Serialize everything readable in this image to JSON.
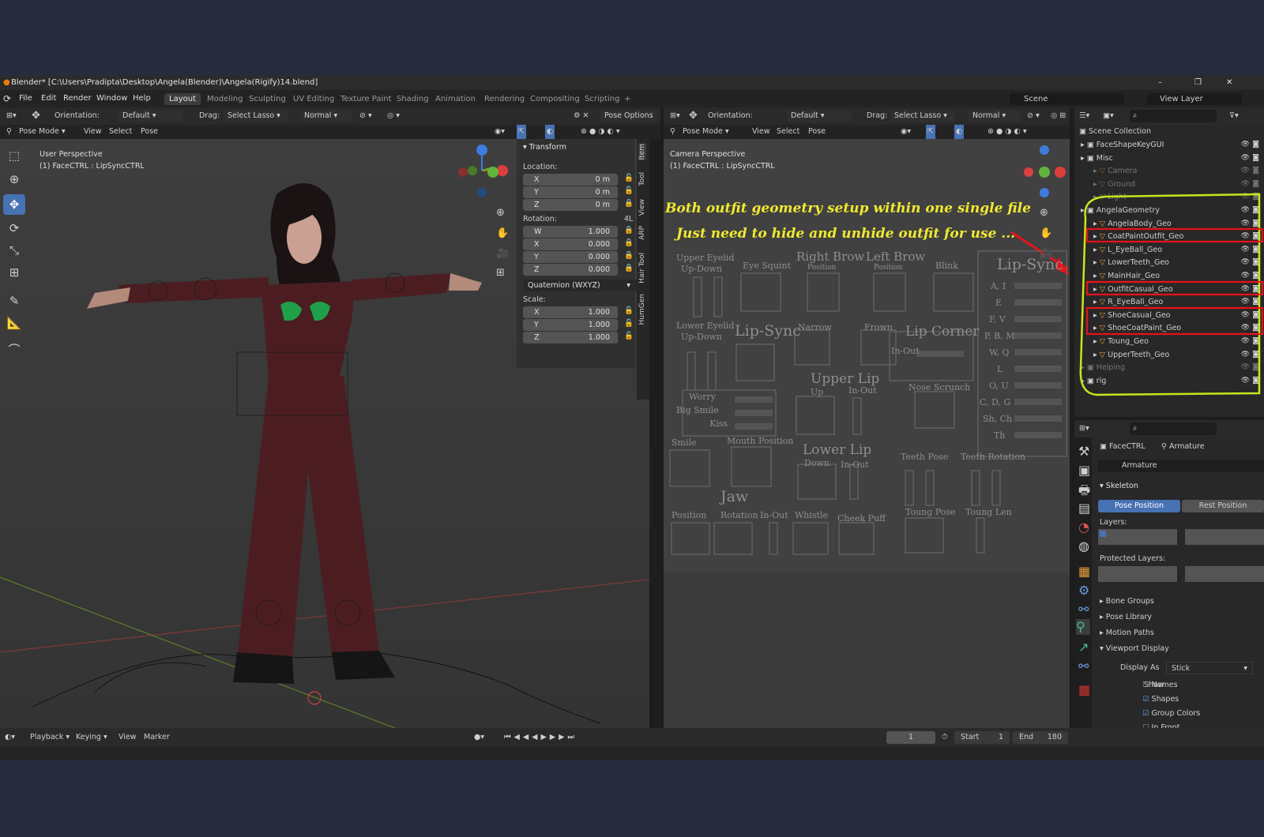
{
  "window": {
    "title": "Blender* [C:\\Users\\Pradipta\\Desktop\\Angela(Blender)\\Angela(Rigify)14.blend]",
    "controls": [
      "–",
      "❐",
      "✕"
    ]
  },
  "menu": [
    "File",
    "Edit",
    "Render",
    "Window",
    "Help"
  ],
  "workspaces": [
    "Layout",
    "Modeling",
    "Sculpting",
    "UV Editing",
    "Texture Paint",
    "Shading",
    "Animation",
    "Rendering",
    "Compositing",
    "Scripting",
    "+"
  ],
  "scene": {
    "label": "Scene",
    "view_layer": "View Layer"
  },
  "left_viewport": {
    "orientation_label": "Orientation:",
    "orientation_value": "Default",
    "drag_label": "Drag:",
    "drag_value": "Select Lasso",
    "pivot": "Normal",
    "pose_options": "Pose Options",
    "mode": "Pose Mode",
    "menus": [
      "View",
      "Select",
      "Pose"
    ],
    "info_line1": "User Perspective",
    "info_line2": "(1) FaceCTRL : LipSyncCTRL",
    "npanel": {
      "header": "Transform",
      "location_label": "Location:",
      "location": [
        {
          "axis": "X",
          "value": "0 m"
        },
        {
          "axis": "Y",
          "value": "0 m"
        },
        {
          "axis": "Z",
          "value": "0 m"
        }
      ],
      "rotation_label": "Rotation:",
      "rotation_mode_hint": "4L",
      "rotation": [
        {
          "axis": "W",
          "value": "1.000"
        },
        {
          "axis": "X",
          "value": "0.000"
        },
        {
          "axis": "Y",
          "value": "0.000"
        },
        {
          "axis": "Z",
          "value": "0.000"
        }
      ],
      "rotation_mode": "Quaternion (WXYZ)",
      "scale_label": "Scale:",
      "scale": [
        {
          "axis": "X",
          "value": "1.000"
        },
        {
          "axis": "Y",
          "value": "1.000"
        },
        {
          "axis": "Z",
          "value": "1.000"
        }
      ],
      "tabs": [
        "Item",
        "Tool",
        "View",
        "ARP",
        "Hair Tool",
        "HumGen"
      ]
    }
  },
  "right_viewport": {
    "orientation_label": "Orientation:",
    "orientation_value": "Default",
    "drag_label": "Drag:",
    "drag_value": "Select Lasso",
    "pivot": "Normal",
    "mode": "Pose Mode",
    "menus": [
      "View",
      "Select",
      "Pose"
    ],
    "info_line1": "Camera Perspective",
    "info_line2": "(1) FaceCTRL : LipSyncCTRL",
    "annotation_line1": "Both outfit geometry setup within one single file",
    "annotation_line2": "Just need to hide and unhide outfit for use ...",
    "face_gui": {
      "upper_eyelid": "Upper Eyelid",
      "up_down": "Up-Down",
      "eye_squint": "Eye Squint",
      "right_brow": "Right Brow",
      "left_brow": "Left Brow",
      "position": "Position",
      "blink": "Blink",
      "lip_sync": "Lip-Sync",
      "lower_eyelid": "Lower Eyelid",
      "lip_sync_small": "Lip-Sync",
      "narrow": "Narrow",
      "frown": "Frown",
      "lip_corner": "Lip Corner",
      "in_out": "In-Out",
      "worry": "Worry",
      "big_smile": "Big Smile",
      "kiss": "Kiss",
      "upper_lip": "Upper Lip",
      "up": "Up",
      "nose_scrunch": "Nose Scrunch",
      "smile": "Smile",
      "mouth_position": "Mouth Position",
      "lower_lip": "Lower Lip",
      "down": "Down",
      "teeth_pose": "Teeth Pose",
      "teeth_rotation": "Teeth Rotation",
      "jaw": "Jaw",
      "rotation": "Rotation",
      "whistle": "Whistle",
      "cheek_puff": "Cheek Puff",
      "toung_pose": "Toung Pose",
      "toung_len": "Toung Len",
      "phonemes": [
        "A, I",
        "E",
        "F, V",
        "P, B, M",
        "W, Q",
        "L",
        "O, U",
        "C, D, G",
        "Sh, Ch",
        "Th"
      ]
    }
  },
  "outliner": {
    "collection": "Scene Collection",
    "items": [
      {
        "name": "FaceShapeKeyGUI",
        "indent": 0
      },
      {
        "name": "Misc",
        "indent": 0
      },
      {
        "name": "Camera",
        "indent": 1,
        "dim": true
      },
      {
        "name": "Ground",
        "indent": 1,
        "dim": true
      },
      {
        "name": "Light",
        "indent": 1,
        "dim": true
      },
      {
        "name": "AngelaGeometry",
        "indent": 0
      },
      {
        "name": "AngelaBody_Geo",
        "indent": 1
      },
      {
        "name": "CoatPaintOutfit_Geo",
        "indent": 1,
        "hl": true
      },
      {
        "name": "L_EyeBall_Geo",
        "indent": 1
      },
      {
        "name": "LowerTeeth_Geo",
        "indent": 1
      },
      {
        "name": "MainHair_Geo",
        "indent": 1
      },
      {
        "name": "OutfitCasual_Geo",
        "indent": 1,
        "hl": true
      },
      {
        "name": "R_EyeBall_Geo",
        "indent": 1
      },
      {
        "name": "ShoeCasual_Geo",
        "indent": 1,
        "hl": true
      },
      {
        "name": "ShoeCoatPaint_Geo",
        "indent": 1,
        "hl": true
      },
      {
        "name": "Toung_Geo",
        "indent": 1
      },
      {
        "name": "UpperTeeth_Geo",
        "indent": 1
      },
      {
        "name": "Helping",
        "indent": 0,
        "dim": true
      },
      {
        "name": "rig",
        "indent": 0
      }
    ]
  },
  "properties": {
    "object": "FaceCTRL",
    "data": "Armature",
    "data_name": "Armature",
    "skeleton": "Skeleton",
    "pose_position": "Pose Position",
    "rest_position": "Rest Position",
    "layers": "Layers:",
    "protected_layers": "Protected Layers:",
    "sections": [
      "Bone Groups",
      "Pose Library",
      "Motion Paths",
      "Viewport Display"
    ],
    "display_as_label": "Display As",
    "display_as": "Stick",
    "show_label": "Show",
    "checks": [
      {
        "label": "Names",
        "on": false
      },
      {
        "label": "Shapes",
        "on": true
      },
      {
        "label": "Group Colors",
        "on": true
      },
      {
        "label": "In Front",
        "on": false
      }
    ]
  },
  "timeline": {
    "menus": [
      "Playback",
      "Keying",
      "View",
      "Marker"
    ],
    "current_frame": "1",
    "start_label": "Start",
    "start": "1",
    "end_label": "End",
    "end": "180"
  },
  "colors": {
    "accent": "#4772b3",
    "annotation": "#f0ea2e",
    "highlight": "#e8121a",
    "outline": "#c8e61a"
  }
}
